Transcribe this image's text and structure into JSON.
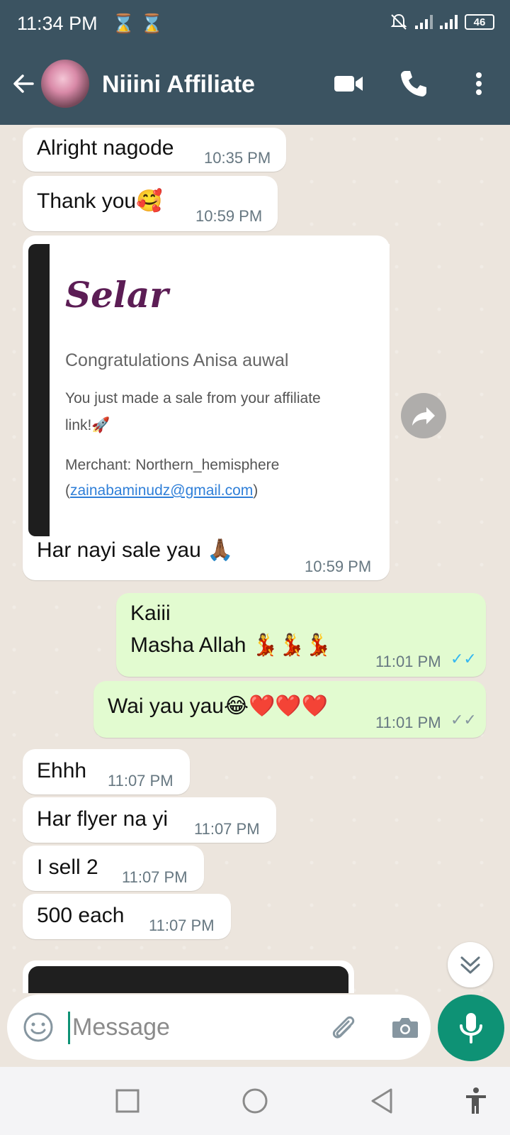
{
  "status_bar": {
    "time": "11:34 PM",
    "battery": "46"
  },
  "header": {
    "title": "Niiini Affiliate"
  },
  "messages": [
    {
      "id": 0,
      "direction": "in",
      "text": "Alright nagode",
      "time": "10:35 PM"
    },
    {
      "id": 1,
      "direction": "in",
      "text": "Thank you🥰",
      "time": "10:59 PM"
    },
    {
      "id": 2,
      "direction": "in",
      "type": "image-caption",
      "text": "Har nayi sale yau 🙏🏾",
      "time": "10:59 PM"
    },
    {
      "id": 3,
      "direction": "out",
      "line1": "Kaiii",
      "line2": "Masha Allah 💃💃💃",
      "time": "11:01 PM",
      "status": "read"
    },
    {
      "id": 4,
      "direction": "out",
      "text": "Wai yau yau😂❤️❤️❤️",
      "time": "11:01 PM",
      "status": "delivered"
    },
    {
      "id": 5,
      "direction": "in",
      "text": "Ehhh",
      "time": "11:07 PM"
    },
    {
      "id": 6,
      "direction": "in",
      "text": "Har flyer na yi",
      "time": "11:07 PM"
    },
    {
      "id": 7,
      "direction": "in",
      "text": "I sell 2",
      "time": "11:07 PM"
    },
    {
      "id": 8,
      "direction": "in",
      "text": "500 each",
      "time": "11:07 PM"
    }
  ],
  "selar_card": {
    "logo": "Selar",
    "heading": "Congratulations Anisa auwal",
    "body_line1": "You just made a sale from your affiliate",
    "body_line2": "link!🚀",
    "merchant_label": "Merchant: Northern_hemisphere",
    "email_prefix": "(",
    "email": "zainabaminudz@gmail.com",
    "email_suffix": ")"
  },
  "composer": {
    "placeholder": "Message"
  },
  "colors": {
    "header_bg": "#3b5361",
    "chat_bg": "#ece5dd",
    "outgoing_bubble": "#e2fbd0",
    "accent": "#0e9275",
    "read_tick": "#34b7f1"
  },
  "icons": {
    "header": [
      "back-arrow-icon",
      "video-call-icon",
      "voice-call-icon",
      "more-options-icon"
    ],
    "composer": [
      "emoji-icon",
      "attach-icon",
      "camera-icon",
      "mic-icon"
    ],
    "navigation": [
      "recents-square-icon",
      "home-circle-icon",
      "back-triangle-icon",
      "accessibility-icon"
    ]
  }
}
